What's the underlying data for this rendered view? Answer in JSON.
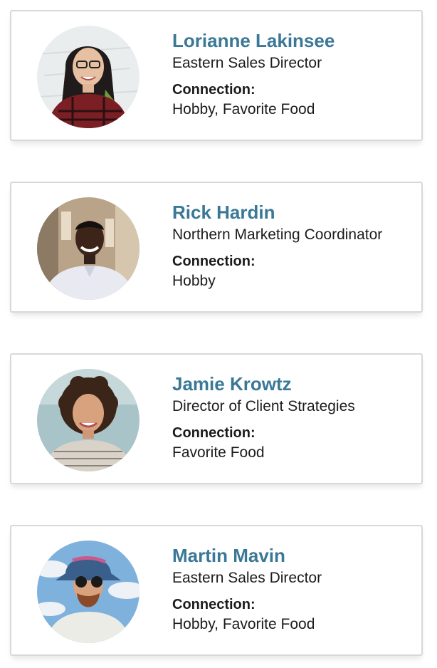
{
  "contacts": [
    {
      "name": "Lorianne Lakinsee",
      "title": "Eastern Sales Director",
      "connection_label": "Connection:",
      "connection": "Hobby, Favorite Food",
      "avatar_icon": "person-photo-woman-glasses",
      "bg_color": "#e9edee"
    },
    {
      "name": "Rick Hardin",
      "title": "Northern Marketing Coordinator",
      "connection_label": "Connection:",
      "connection": "Hobby",
      "avatar_icon": "person-photo-man-smiling",
      "bg_color": "#b9a48a"
    },
    {
      "name": "Jamie Krowtz",
      "title": "Director of Client Strategies",
      "connection_label": "Connection:",
      "connection": "Favorite Food",
      "avatar_icon": "person-photo-woman-curly-hair",
      "bg_color": "#a9c4c8"
    },
    {
      "name": "Martin Mavin",
      "title": "Eastern Sales Director",
      "connection_label": "Connection:",
      "connection": "Hobby, Favorite Food",
      "avatar_icon": "person-photo-man-bucket-hat",
      "bg_color": "#7fb1dd"
    }
  ]
}
